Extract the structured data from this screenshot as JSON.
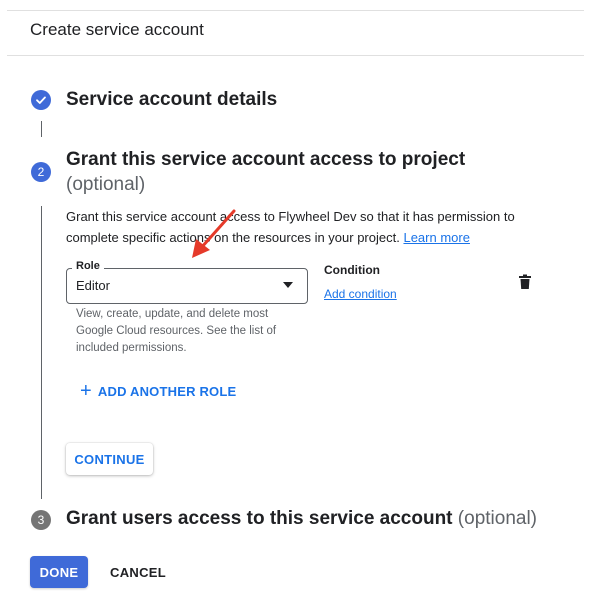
{
  "header": {
    "title": "Create service account"
  },
  "steps": [
    {
      "title": "Service account details",
      "status": "complete"
    },
    {
      "number": "2",
      "title": "Grant this service account access to project",
      "optional": "(optional)",
      "description_before": "Grant this service account access to Flywheel Dev so that it has permission to complete specific actions on the resources in your project.",
      "learn_more": "Learn more",
      "role": {
        "label": "Role",
        "value": "Editor",
        "help": "View, create, update, and delete most Google Cloud resources. See the list of included permissions."
      },
      "condition": {
        "label": "Condition",
        "add_link": "Add condition"
      },
      "add_role_label": "ADD ANOTHER ROLE",
      "continue_label": "CONTINUE"
    },
    {
      "number": "3",
      "title": "Grant users access to this service account",
      "optional": "(optional)"
    }
  ],
  "footer": {
    "done_label": "DONE",
    "cancel_label": "CANCEL"
  },
  "colors": {
    "accent": "#3f6ad8",
    "link": "#1a73e8",
    "annotation_arrow": "#e53a2a"
  },
  "icons": {
    "step1": "check-icon",
    "delete": "trash-icon",
    "add": "plus-icon",
    "dropdown": "caret-down-icon"
  }
}
